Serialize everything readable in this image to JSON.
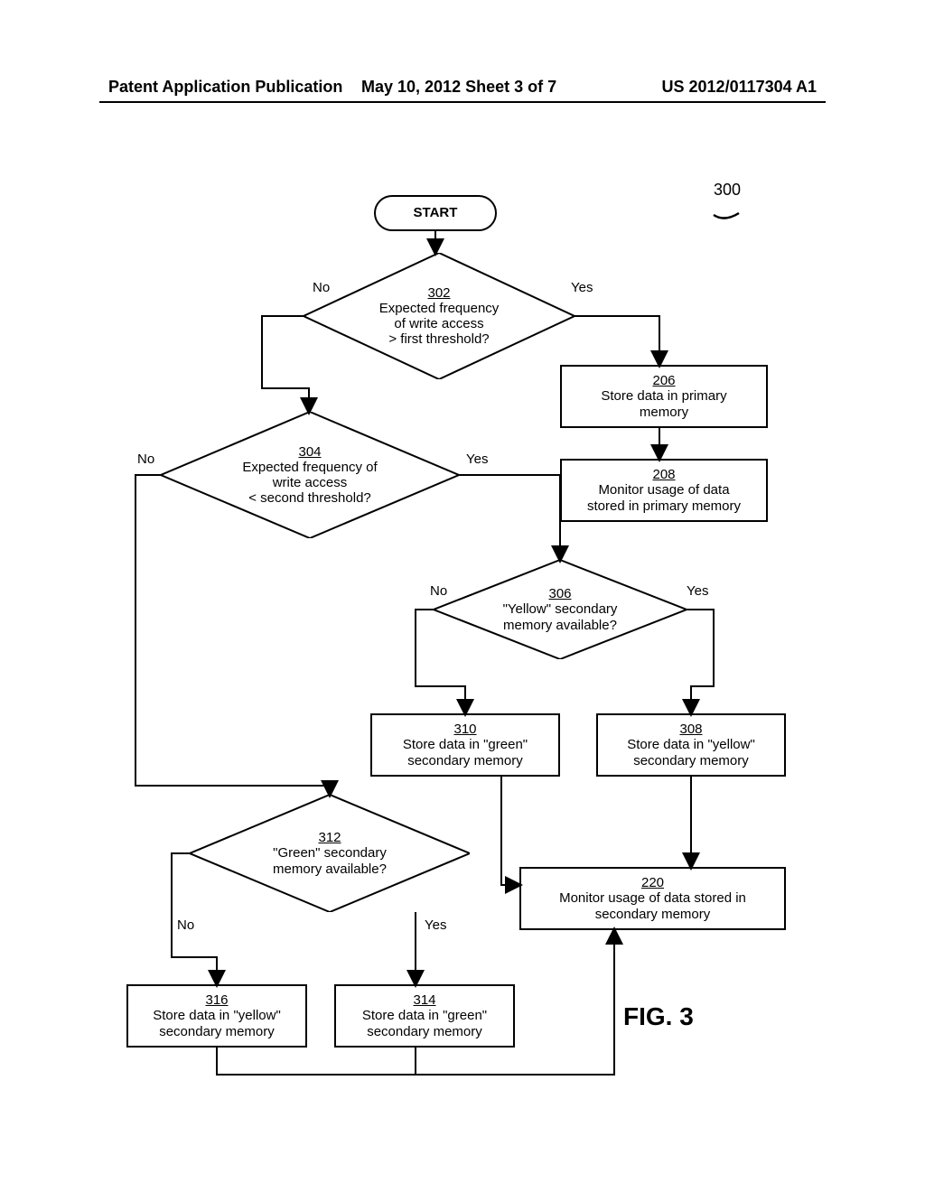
{
  "header": {
    "left": "Patent Application Publication",
    "center": "May 10, 2012  Sheet 3 of 7",
    "right": "US 2012/0117304 A1"
  },
  "diagram": {
    "refnum": "300",
    "start": "START",
    "d302": {
      "ref": "302",
      "text": "Expected frequency\nof write access\n> first threshold?"
    },
    "d304": {
      "ref": "304",
      "text": "Expected frequency of\nwrite access\n< second threshold?"
    },
    "d306": {
      "ref": "306",
      "text": "\"Yellow\" secondary\nmemory available?"
    },
    "d312": {
      "ref": "312",
      "text": "\"Green\" secondary\nmemory available?"
    },
    "b206": {
      "ref": "206",
      "text": "Store data in primary\nmemory"
    },
    "b208": {
      "ref": "208",
      "text": "Monitor usage of data\nstored in primary memory"
    },
    "b308": {
      "ref": "308",
      "text": "Store data in \"yellow\"\nsecondary memory"
    },
    "b310": {
      "ref": "310",
      "text": "Store data in \"green\"\nsecondary memory"
    },
    "b220": {
      "ref": "220",
      "text": "Monitor usage of data stored in\nsecondary memory"
    },
    "b314": {
      "ref": "314",
      "text": "Store data in \"green\"\nsecondary memory"
    },
    "b316": {
      "ref": "316",
      "text": "Store data in \"yellow\"\nsecondary memory"
    },
    "labels": {
      "yes": "Yes",
      "no": "No"
    },
    "figure": "FIG. 3"
  }
}
